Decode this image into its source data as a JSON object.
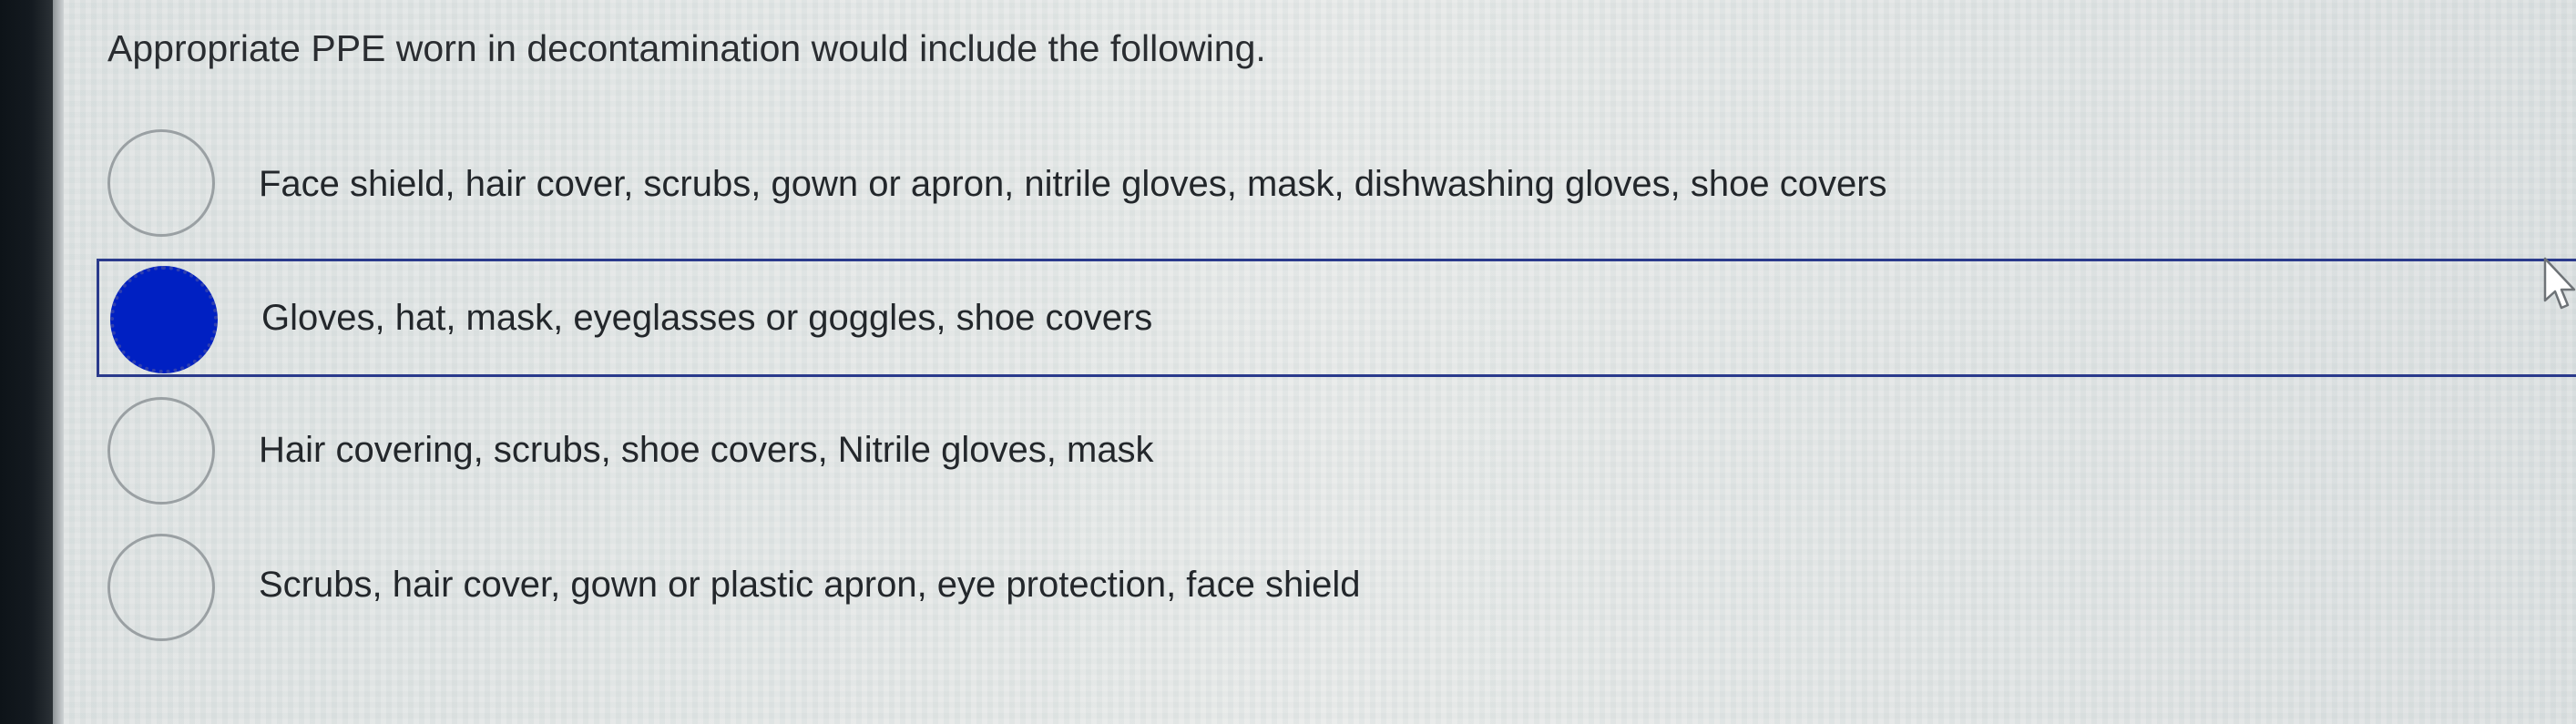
{
  "question": {
    "text": "Appropriate PPE worn in decontamination would include the following."
  },
  "options": [
    {
      "label": "Face shield, hair cover, scrubs, gown or apron, nitrile gloves, mask, dishwashing gloves, shoe covers",
      "selected": false
    },
    {
      "label": "Gloves, hat, mask, eyeglasses or goggles, shoe covers",
      "selected": true
    },
    {
      "label": "Hair covering, scrubs, shoe covers, Nitrile gloves, mask",
      "selected": false
    },
    {
      "label": "Scrubs, hair cover, gown or plastic apron, eye protection, face shield",
      "selected": false
    }
  ],
  "colors": {
    "selected_radio": "#0020c2",
    "selected_border": "#2a3a8c"
  },
  "icons": {
    "cursor": "mouse-pointer-icon"
  }
}
